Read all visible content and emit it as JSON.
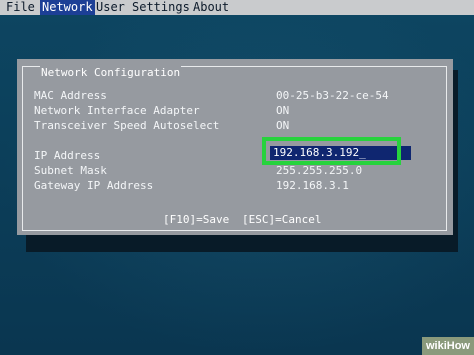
{
  "menubar": {
    "items": [
      {
        "label": "File"
      },
      {
        "label": "Network"
      },
      {
        "label": "User"
      },
      {
        "label": "Settings"
      },
      {
        "label": "About"
      }
    ],
    "active": "Network"
  },
  "dialog": {
    "title": "Network Configuration",
    "rows": [
      {
        "label": "MAC Address",
        "value": "00-25-b3-22-ce-54"
      },
      {
        "label": "Network Interface Adapter",
        "value": "ON"
      },
      {
        "label": "Transceiver Speed Autoselect",
        "value": "ON"
      },
      {
        "label": "IP Address",
        "value": "192.168.3.192_"
      },
      {
        "label": "Subnet Mask",
        "value": "255.255.255.0"
      },
      {
        "label": "Gateway IP Address",
        "value": "192.168.3.1"
      }
    ],
    "hints": {
      "save": "[F10]=Save",
      "cancel": "[ESC]=Cancel"
    }
  },
  "watermark": "wikiHow",
  "colors": {
    "highlight": "#27d33d",
    "field_bg": "#0f2670",
    "menu_active_bg": "#1c3f96"
  }
}
